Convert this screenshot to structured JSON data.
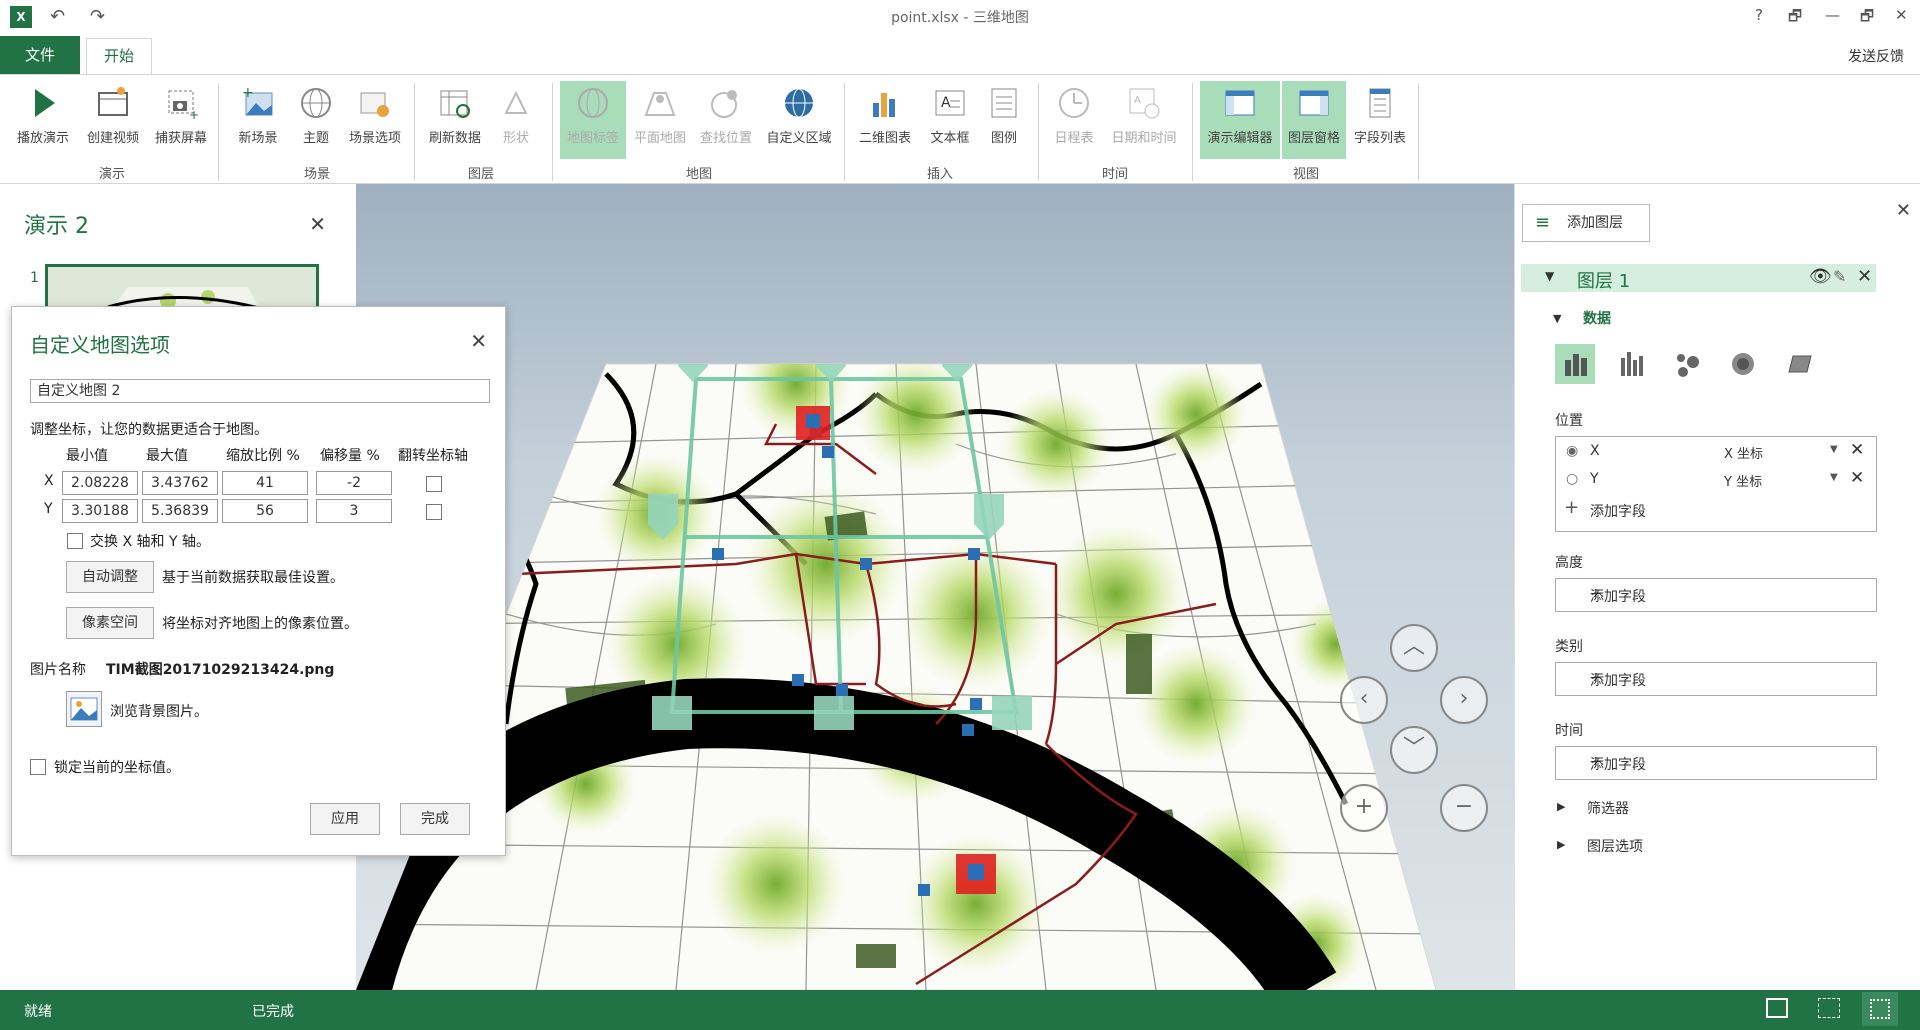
{
  "window": {
    "title": "point.xlsx - 三维地图",
    "help_glyph": "?",
    "restore_glyph": "🗗",
    "minimize_glyph": "—",
    "maximize_glyph": "🗗",
    "close_glyph": "✕"
  },
  "tabs": {
    "file": "文件",
    "home": "开始",
    "feedback": "发送反馈"
  },
  "ribbon": {
    "buttons": {
      "play_tour": "播放演示",
      "create_video": "创建视频",
      "capture_screen": "捕获屏幕",
      "new_scene": "新场景",
      "themes": "主题",
      "scene_options": "场景选项",
      "refresh_data": "刷新数据",
      "shapes": "形状",
      "map_labels": "地图标签",
      "flat_map": "平面地图",
      "find_location": "查找位置",
      "custom_regions": "自定义区域",
      "chart_2d": "二维图表",
      "text_box": "文本框",
      "legend": "图例",
      "timeline": "日程表",
      "date_time": "日期和时间",
      "tour_editor": "演示编辑器",
      "layer_pane": "图层窗格",
      "field_list": "字段列表"
    },
    "groups": {
      "tour": "演示",
      "scene": "场景",
      "layer": "图层",
      "map": "地图",
      "insert": "插入",
      "time": "时间",
      "view": "视图"
    }
  },
  "left_pane": {
    "title": "演示 2",
    "close": "✕",
    "scene_number": "1"
  },
  "dialog": {
    "title": "自定义地图选项",
    "close": "✕",
    "map_name": "自定义地图 2",
    "instruction": "调整坐标，让您的数据更适合于地图。",
    "headers": {
      "min": "最小值",
      "max": "最大值",
      "scale": "缩放比例 %",
      "offset": "偏移量 %",
      "flip": "翻转坐标轴"
    },
    "rows": [
      {
        "axis": "X",
        "min": "2.08228",
        "max": "3.43762",
        "scale": "41",
        "offset": "-2"
      },
      {
        "axis": "Y",
        "min": "3.30188",
        "max": "5.36839",
        "scale": "56",
        "offset": "3"
      }
    ],
    "swap_axes": "交换 X 轴和 Y 轴。",
    "auto_adjust": "自动调整",
    "auto_adjust_desc": "基于当前数据获取最佳设置。",
    "pixel_space": "像素空间",
    "pixel_space_desc": "将坐标对齐地图上的像素位置。",
    "image_label": "图片名称",
    "image_name": "TIM截图20171029213424.png",
    "browse": "浏览背景图片。",
    "lock": "锁定当前的坐标值。",
    "apply": "应用",
    "done": "完成"
  },
  "right_pane": {
    "close": "✕",
    "add_layer": "添加图层",
    "layer_name": "图层 1",
    "data_section": "数据",
    "location_label": "位置",
    "location_rows": [
      {
        "field": "X",
        "type": "X 坐标"
      },
      {
        "field": "Y",
        "type": "Y 坐标"
      }
    ],
    "add_field": "添加字段",
    "height_label": "高度",
    "category_label": "类别",
    "time_label": "时间",
    "filters": "筛选器",
    "layer_options": "图层选项"
  },
  "status": {
    "ready": "就绪",
    "completed": "已完成"
  },
  "colors": {
    "accent": "#217346",
    "active_button": "#a9dcb9",
    "heatmap": "#9acd32",
    "marker_red": "#e02020"
  }
}
